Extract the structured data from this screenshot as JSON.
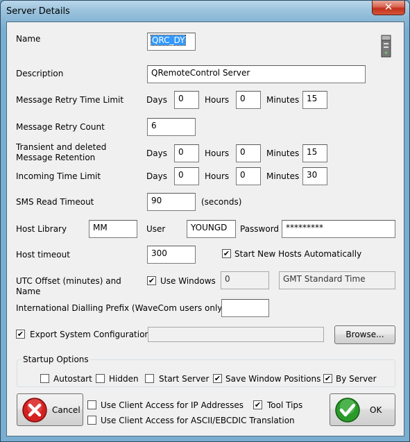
{
  "window": {
    "title": "Server Details",
    "close_glyph": "✕"
  },
  "fields": {
    "name_label": "Name",
    "name_value": "QRC_DY",
    "description_label": "Description",
    "description_value": "QRemoteControl Server",
    "retry_time_label": "Message Retry Time Limit",
    "retry_time": {
      "days": "0",
      "hours": "0",
      "minutes": "15"
    },
    "retry_count_label": "Message Retry Count",
    "retry_count_value": "6",
    "retention_label_1": "Transient and deleted",
    "retention_label_2": "Message Retention",
    "retention": {
      "days": "0",
      "hours": "0",
      "minutes": "15"
    },
    "incoming_label": "Incoming Time Limit",
    "incoming": {
      "days": "0",
      "hours": "0",
      "minutes": "30"
    },
    "days_label": "Days",
    "hours_label": "Hours",
    "minutes_label": "Minutes",
    "sms_label": "SMS Read Timeout",
    "sms_value": "90",
    "seconds_label": "(seconds)",
    "host_library_label": "Host Library",
    "host_library_value": "MM",
    "user_label": "User",
    "user_value": "YOUNGD",
    "password_label": "Password",
    "password_value": "*********",
    "host_timeout_label": "Host timeout",
    "host_timeout_value": "300",
    "start_hosts_label": "Start New Hosts Automatically",
    "utc_label_1": "UTC Offset (minutes) and",
    "utc_label_2": "Name",
    "use_windows_label": "Use Windows",
    "utc_offset_value": "0",
    "utc_name_value": "GMT Standard Time",
    "dialling_label": "International Dialling Prefix (WaveCom users only)",
    "dialling_value": "",
    "export_label": "Export System Configuration",
    "export_path_value": "",
    "browse_label": "Browse..."
  },
  "startup": {
    "group_label": "Startup Options",
    "autostart": "Autostart",
    "hidden": "Hidden",
    "start_server": "Start Server",
    "save_positions": "Save Window Positions",
    "by_server": "By Server"
  },
  "bottom": {
    "cancel_label": "Cancel",
    "ok_label": "OK",
    "client_ip_label": "Use Client Access for IP Addresses",
    "tool_tips_label": "Tool Tips",
    "client_ascii_label": "Use Client Access for ASCII/EBCDIC Translation"
  },
  "checks": {
    "start_hosts": true,
    "use_windows": true,
    "export": true,
    "autostart": false,
    "hidden": false,
    "start_server": false,
    "save_positions": true,
    "by_server": true,
    "client_ip": false,
    "tool_tips": true,
    "client_ascii": false
  },
  "colors": {
    "cancel_red": "#d42020",
    "ok_green": "#2a9a2a",
    "selection": "#3399ff"
  }
}
